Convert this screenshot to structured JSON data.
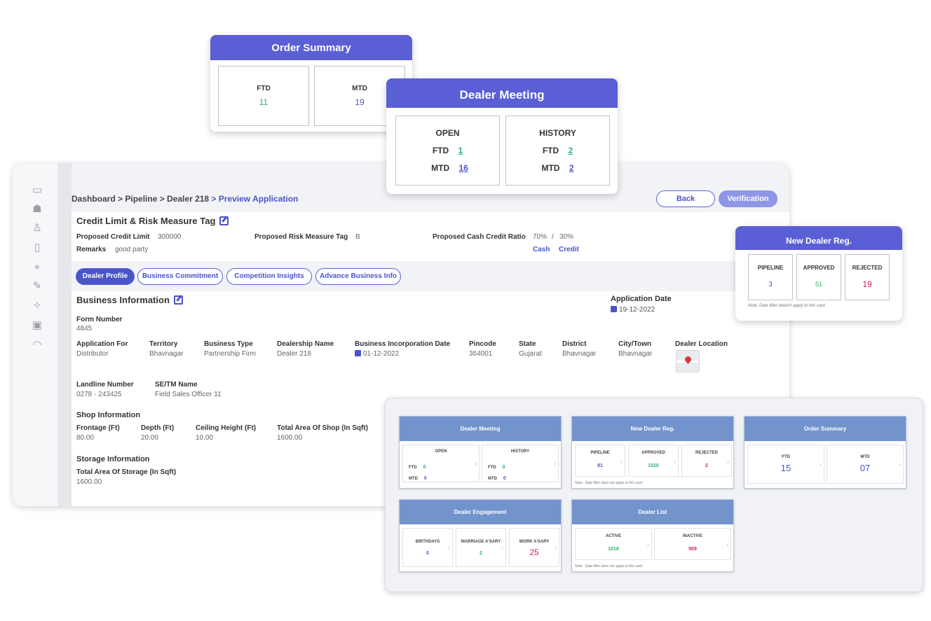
{
  "breadcrumb": {
    "path": "Dashboard > Pipeline > Dealer 218",
    "current": " > Preview Application"
  },
  "actions": {
    "back": "Back",
    "verification": "Verification"
  },
  "credit": {
    "title": "Credit Limit & Risk Measure Tag",
    "limit_label": "Proposed Credit Limit",
    "limit_value": "300000",
    "risk_label": "Proposed Risk Measure Tag",
    "risk_value": "B",
    "ratio_label": "Proposed Cash Credit Ratio",
    "ratio_cash": "70%",
    "ratio_sep": "/",
    "ratio_credit": "30%",
    "remarks_label": "Remarks",
    "remarks_value": "good party",
    "cash_link": "Cash",
    "credit_link": "Credit"
  },
  "tabs": [
    "Dealer Profile",
    "Business Commitment",
    "Competition Insights",
    "Advance Business Info"
  ],
  "business": {
    "title": "Business Information",
    "app_date_label": "Application Date",
    "app_date_value": "19-12-2022",
    "form_number_label": "Form Number",
    "form_number_value": "4845",
    "fields": [
      {
        "label": "Application For",
        "value": "Distributor"
      },
      {
        "label": "Territory",
        "value": "Bhavnagar"
      },
      {
        "label": "Business Type",
        "value": "Partnership Firm"
      },
      {
        "label": "Dealership Name",
        "value": "Dealer 218"
      },
      {
        "label": "Business Incorporation Date",
        "value": "01-12-2022"
      },
      {
        "label": "Pincode",
        "value": "364001"
      },
      {
        "label": "State",
        "value": "Gujarat"
      },
      {
        "label": "District",
        "value": "Bhavnagar"
      },
      {
        "label": "City/Town",
        "value": "Bhavnagar"
      },
      {
        "label": "Dealer Location",
        "value": ""
      }
    ],
    "landline_label": "Landline Number",
    "landline_value": "0278 - 243425",
    "setm_label": "SE/TM Name",
    "setm_value": "Field Sales Officer 11",
    "shop_title": "Shop Information",
    "shop": [
      {
        "label": "Frontage (Ft)",
        "value": "80.00"
      },
      {
        "label": "Depth (Ft)",
        "value": "20.00"
      },
      {
        "label": "Ceiling Height (Ft)",
        "value": "10.00"
      },
      {
        "label": "Total Area Of Shop (In Sqft)",
        "value": "1600.00"
      }
    ],
    "storage_title": "Storage Information",
    "storage_label": "Total Area Of Storage (In Sqft)",
    "storage_value": "1600.00"
  },
  "order_summary_card": {
    "title": "Order Summary",
    "ftd_label": "FTD",
    "ftd_value": "11",
    "mtd_label": "MTD",
    "mtd_value": "19"
  },
  "dealer_meeting_card": {
    "title": "Dealer Meeting",
    "open_label": "OPEN",
    "history_label": "HISTORY",
    "ftd_label": "FTD",
    "mtd_label": "MTD",
    "open_ftd": "1",
    "open_mtd": "16",
    "history_ftd": "2",
    "history_mtd": "2"
  },
  "new_dealer_card": {
    "title": "New Dealer Reg.",
    "pipeline_label": "PIPELINE",
    "pipeline_value": "3",
    "approved_label": "APPROVED",
    "approved_value": "51",
    "rejected_label": "REJECTED",
    "rejected_value": "19",
    "note": "Note: Date filter doesn't apply to this card"
  },
  "mini": {
    "meeting": {
      "title": "Dealer Meeting",
      "open": "OPEN",
      "history": "HISTORY",
      "ftd": "FTD",
      "mtd": "MTD",
      "open_ftd": "0",
      "open_mtd": "0",
      "hist_ftd": "0",
      "hist_mtd": "0"
    },
    "newreg": {
      "title": "New Dealer Reg.",
      "pipeline": "PIPELINE",
      "pipeline_val": "81",
      "approved": "APPROVED",
      "approved_val": "1020",
      "rejected": "REJECTED",
      "rejected_val": "2",
      "note": "Note : Date filter does not apply to this card"
    },
    "order": {
      "title": "Order Summary",
      "ftd": "FTD",
      "ftd_val": "15",
      "mtd": "MTD",
      "mtd_val": "07"
    },
    "engagement": {
      "title": "Dealer Engagement",
      "birthdays": "BIRTHDAYS",
      "birthdays_val": "0",
      "marriage": "MARRIAGE A'SARY",
      "marriage_val": "2",
      "work": "WORK A'SARY",
      "work_val": "25"
    },
    "list": {
      "title": "Dealer List",
      "active": "ACTIVE",
      "active_val": "1018",
      "inactive": "INACTIVE",
      "inactive_val": "509",
      "note": "Note : Date filter does not apply to this card"
    }
  },
  "colors": {
    "brand": "#5a5fd6",
    "link": "#4a55c8",
    "positive": "#2fb36a",
    "negative": "#d02255",
    "mini_header": "#7393cc"
  },
  "icons": [
    "monitor-icon",
    "team-icon",
    "people-icon",
    "document-icon",
    "map-pin-icon",
    "edit-doc-icon",
    "celebration-icon",
    "id-card-icon",
    "headset-icon"
  ]
}
